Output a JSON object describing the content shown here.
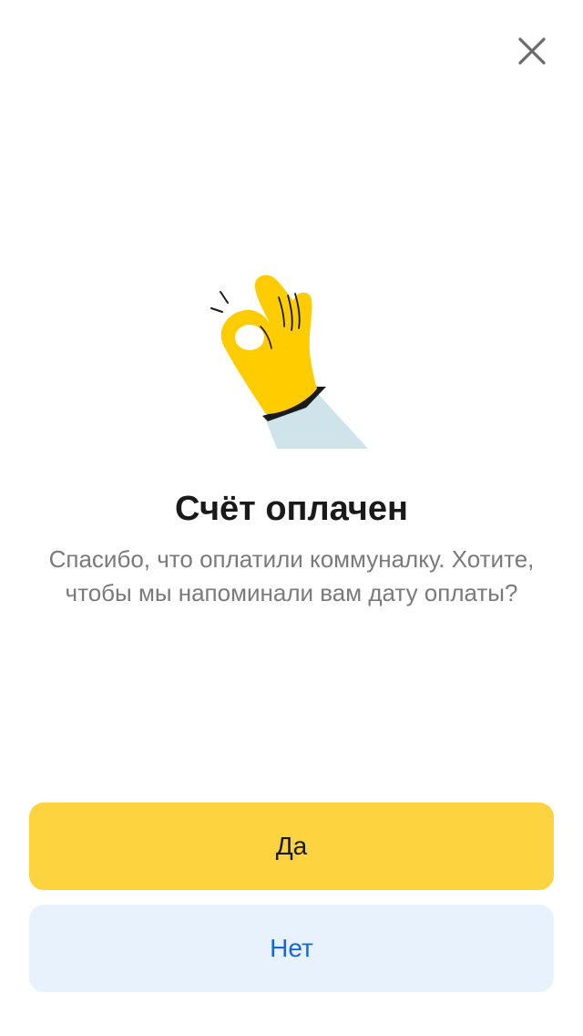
{
  "dialog": {
    "close_icon": "close-icon",
    "illustration": "ok-hand-gesture",
    "title": "Счёт оплачен",
    "message": "Спасибо, что оплатили коммуналку. Хотите, чтобы мы напоминали вам дату оплаты?",
    "yes_label": "Да",
    "no_label": "Нет"
  },
  "colors": {
    "primary_button": "#fdd33f",
    "secondary_button": "#e8f2fd",
    "secondary_text": "#1668d9",
    "hand": "#ffcc00",
    "sleeve": "#cfe4ea"
  }
}
